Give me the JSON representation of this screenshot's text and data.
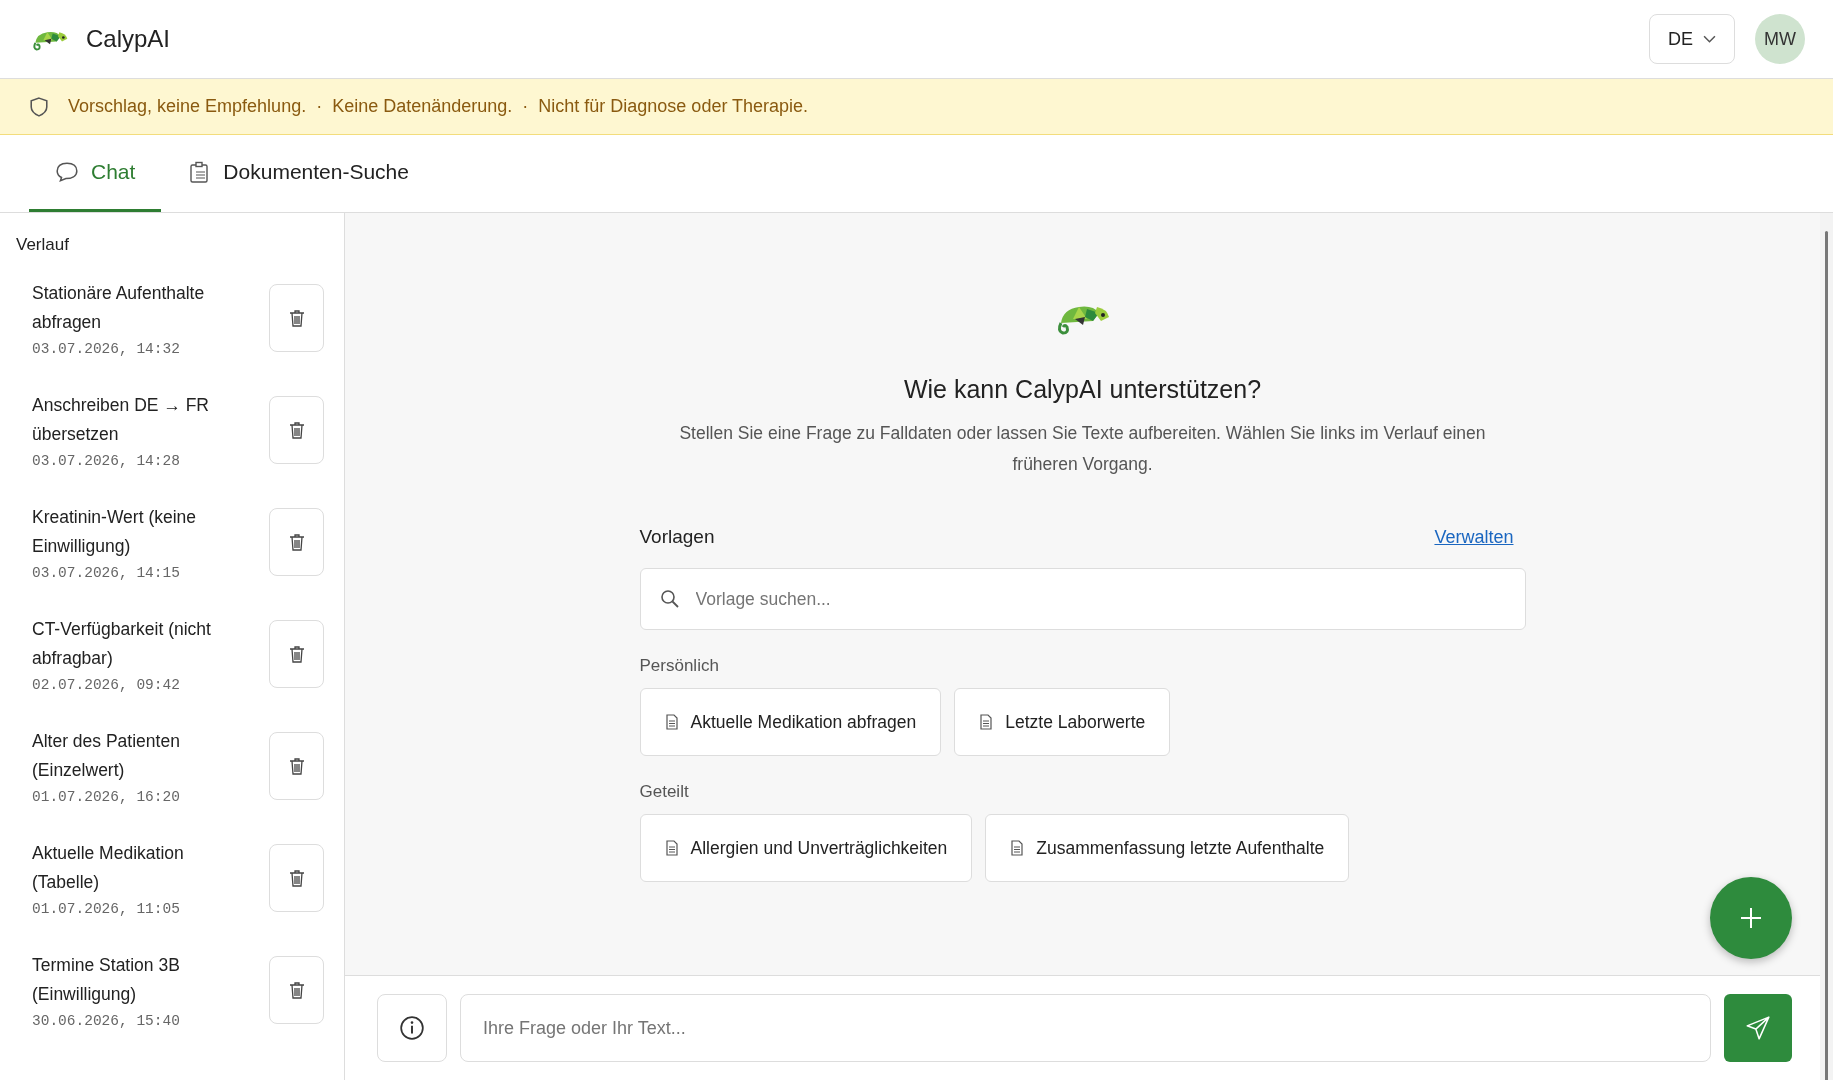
{
  "header": {
    "app_name": "CalypAI",
    "language": "DE",
    "avatar_initials": "MW"
  },
  "notice": {
    "parts": [
      "Vorschlag, keine Empfehlung.",
      "Keine Datenänderung.",
      "Nicht für Diagnose oder Therapie."
    ],
    "separator": "·"
  },
  "tabs": [
    {
      "label": "Chat",
      "kind": "chat",
      "selected": true
    },
    {
      "label": "Dokumenten-Suche",
      "kind": "documents",
      "selected": false
    }
  ],
  "sidebar": {
    "title": "Verlauf",
    "items": [
      {
        "title": "Stationäre Aufenthalte abfragen",
        "date": "03.07.2026, 14:32"
      },
      {
        "title": "Anschreiben DE → FR übersetzen",
        "date": "03.07.2026, 14:28"
      },
      {
        "title": "Kreatinin-Wert (keine Einwilligung)",
        "date": "03.07.2026, 14:15"
      },
      {
        "title": "CT-Verfügbarkeit (nicht abfragbar)",
        "date": "02.07.2026, 09:42"
      },
      {
        "title": "Alter des Patienten (Einzelwert)",
        "date": "01.07.2026, 16:20"
      },
      {
        "title": "Aktuelle Medikation (Tabelle)",
        "date": "01.07.2026, 11:05"
      },
      {
        "title": "Termine Station 3B (Einwilligung)",
        "date": "30.06.2026, 15:40"
      }
    ]
  },
  "welcome": {
    "heading": "Wie kann CalypAI unterstützen?",
    "text": "Stellen Sie eine Frage zu Falldaten oder lassen Sie Texte aufbereiten. Wählen Sie links im Verlauf einen früheren Vorgang."
  },
  "templates": {
    "title": "Vorlagen",
    "manage_link": "Verwalten",
    "search_placeholder": "Vorlage suchen...",
    "groups": [
      {
        "label": "Persönlich",
        "items": [
          "Aktuelle Medikation abfragen",
          "Letzte Laborwerte"
        ]
      },
      {
        "label": "Geteilt",
        "items": [
          "Allergien und Unverträglichkeiten",
          "Zusammenfassung letzte Aufenthalte"
        ]
      }
    ]
  },
  "composer": {
    "placeholder": "Ihre Frage oder Ihr Text..."
  }
}
